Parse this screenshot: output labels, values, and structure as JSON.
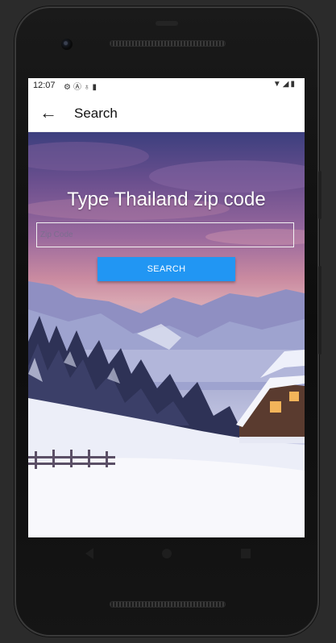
{
  "status_bar": {
    "time": "12:07",
    "left_icons": [
      "settings-icon",
      "vpn-icon",
      "debug-icon",
      "sd-card-icon"
    ],
    "right_icons": [
      "wifi-icon",
      "signal-icon",
      "battery-icon"
    ]
  },
  "app_bar": {
    "title": "Search",
    "back_icon": "arrow-left-icon"
  },
  "main": {
    "headline": "Type Thailand zip code",
    "zip_input": {
      "placeholder": "Zip Code",
      "value": ""
    },
    "search_button_label": "SEARCH"
  },
  "nav_bar": {
    "buttons": [
      "back-triangle-icon",
      "home-circle-icon",
      "recents-square-icon"
    ]
  },
  "colors": {
    "accent": "#2196f3",
    "app_bar_bg": "#ffffff",
    "headline_text": "#ffffff"
  }
}
